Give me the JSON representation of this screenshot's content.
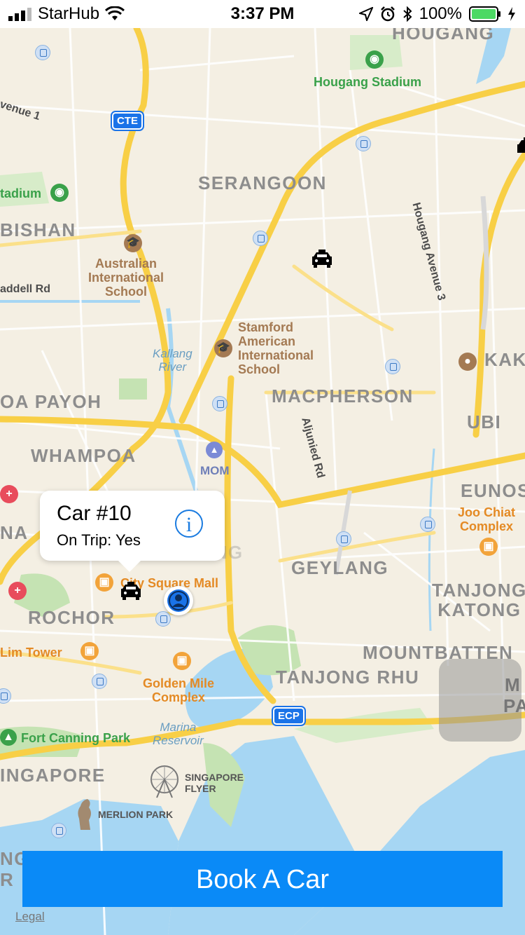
{
  "status_bar": {
    "carrier": "StarHub",
    "time": "3:37 PM",
    "battery": "100%"
  },
  "map": {
    "districts": {
      "hougang": "HOUGANG",
      "serangoon": "SERANGOON",
      "bishan": "BISHAN",
      "macpherson": "MACPHERSON",
      "toa_payoh": "OA PAYOH",
      "whampoa": "WHAMPOA",
      "ubi": "UBI",
      "kak": "KAK",
      "eunos": "EUNOS",
      "geylang": "GEYLANG",
      "tanjong_katong": "TANJONG\nKATONG",
      "rochor": "ROCHOR",
      "mountbatten": "MOUNTBATTEN",
      "tanjong_rhu": "TANJONG RHU",
      "singapore": "INGAPORE",
      "kallang": "KALLANG",
      "na": "NA",
      "ng": "NG",
      "r": "R",
      "m": "M",
      "pa": "PA"
    },
    "parks": {
      "hougang_stadium": "Hougang Stadium",
      "stadium": "tadium",
      "fort_canning_park": "Fort Canning Park"
    },
    "schools": {
      "australian_school": "Australian\nInternational\nSchool",
      "stamford_school": "Stamford\nAmerican\nInternational\nSchool"
    },
    "malls": {
      "city_square_mall": "City Square Mall",
      "golden_mile": "Golden Mile\nComplex",
      "joo_chiat": "Joo Chiat\nComplex",
      "lim_tower": "Lim Tower"
    },
    "water": {
      "kallang_river": "Kallang\nRiver",
      "marina_reservoir": "Marina\nReservoir"
    },
    "roads": {
      "avenue1": "venue 1",
      "addell_rd": "addell Rd",
      "hougang_ave3": "Hougang Avenue 3",
      "aljunied_rd": "Aljunied Rd"
    },
    "landmarks": {
      "mom": "MOM",
      "singapore_flyer": "SINGAPORE\nFLYER",
      "merlion_park": "MERLION PARK"
    },
    "shields": {
      "cte": "CTE",
      "ecp": "ECP"
    }
  },
  "callout": {
    "title": "Car #10",
    "subtitle": "On Trip: Yes"
  },
  "book_button": "Book A Car",
  "legal": "Legal",
  "colors": {
    "accent": "#0a8af7",
    "road_major": "#f8cf46",
    "water": "#a6d6f3",
    "park": "#c5e3b3"
  },
  "icons": [
    "signal-icon",
    "wifi-icon",
    "location-arrow-icon",
    "alarm-icon",
    "bluetooth-icon",
    "battery-icon",
    "taxi-icon",
    "user-location-icon",
    "info-icon",
    "mrt-icon",
    "school-icon",
    "mall-icon",
    "hospital-icon",
    "stadium-icon"
  ]
}
